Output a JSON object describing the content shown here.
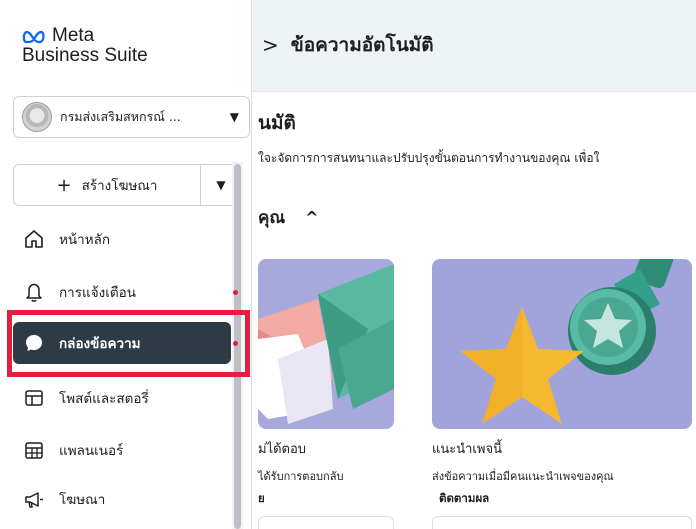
{
  "main": {
    "breadcrumb_sep": ">",
    "breadcrumb_title": "ข้อความอัตโนมัติ",
    "title_partial": "นมัติ",
    "description_partial": "ใจะจัดการการสนทนาและปรับปรุงขั้นตอนการทำงานของคุณ เพื่อใ",
    "section_partial": "คุณ",
    "section_caret": "^",
    "cards": [
      {
        "title_partial": "ม่ได้ตอบ",
        "subtitle_partial": "ได้รับการตอบกลับ",
        "badge_partial": "ย"
      },
      {
        "title": "แนะนำเพจนี้",
        "subtitle": "ส่งข้อความเมื่อมีคนแนะนำเพจของคุณ",
        "badge": "ติดตามผล"
      }
    ]
  },
  "sidebar": {
    "logo_line1": "Meta",
    "logo_line2": "Business Suite",
    "account_name": "กรมส่งเสริมสหกรณ์ ...",
    "create_label": "สร้างโฆษณา",
    "items": [
      {
        "label": "หน้าหลัก",
        "icon": "home-icon",
        "notification": false
      },
      {
        "label": "การแจ้งเตือน",
        "icon": "bell-icon",
        "notification": true
      },
      {
        "label": "กล่องข้อความ",
        "icon": "chat-bubble-icon",
        "notification": true,
        "active": true
      },
      {
        "label": "โพสต์และสตอรี่",
        "icon": "posts-icon",
        "notification": false
      },
      {
        "label": "แพลนเนอร์",
        "icon": "calendar-icon",
        "notification": false
      },
      {
        "label": "โฆษณา",
        "icon": "megaphone-icon",
        "notification": false
      }
    ]
  },
  "colors": {
    "active_item_bg": "#2f3b44",
    "highlight_border": "#e41e3f",
    "header_bg": "#eef3f5",
    "card_bg": "#a1a3db"
  }
}
